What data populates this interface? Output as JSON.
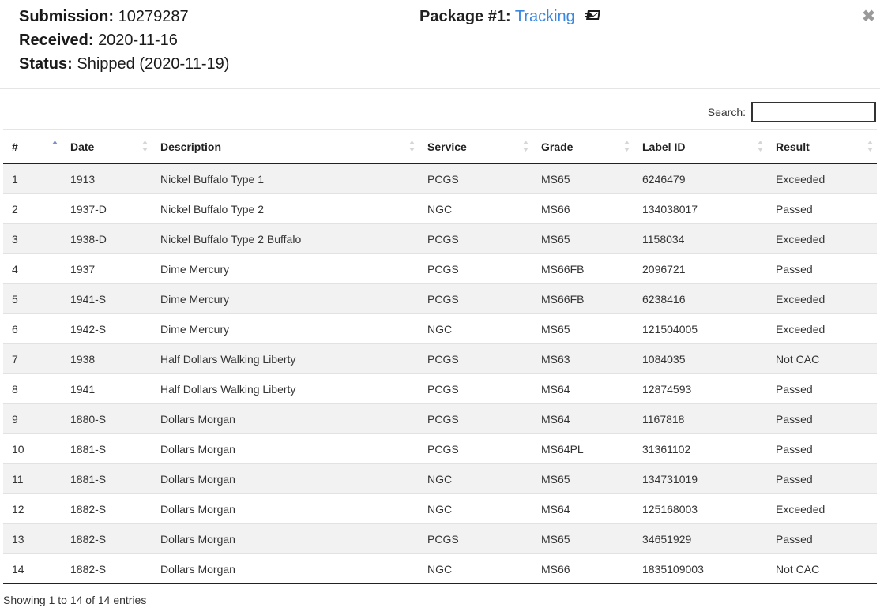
{
  "header": {
    "submission_label": "Submission:",
    "submission_value": "10279287",
    "received_label": "Received:",
    "received_value": "2020-11-16",
    "status_label": "Status:",
    "status_value": "Shipped (2020-11-19)",
    "package_label": "Package #1:",
    "tracking_link": "Tracking",
    "mail_icon": "usps-mail-icon",
    "close_glyph": "✖"
  },
  "search": {
    "label": "Search:",
    "value": ""
  },
  "table": {
    "columns": [
      "#",
      "Date",
      "Description",
      "Service",
      "Grade",
      "Label ID",
      "Result"
    ],
    "sorted_column": "#",
    "sort_direction": "ascending",
    "rows": [
      [
        "1",
        "1913",
        "Nickel Buffalo Type 1",
        "PCGS",
        "MS65",
        "6246479",
        "Exceeded"
      ],
      [
        "2",
        "1937-D",
        "Nickel Buffalo Type 2",
        "NGC",
        "MS66",
        "134038017",
        "Passed"
      ],
      [
        "3",
        "1938-D",
        "Nickel Buffalo Type 2 Buffalo",
        "PCGS",
        "MS65",
        "1158034",
        "Exceeded"
      ],
      [
        "4",
        "1937",
        "Dime Mercury",
        "PCGS",
        "MS66FB",
        "2096721",
        "Passed"
      ],
      [
        "5",
        "1941-S",
        "Dime Mercury",
        "PCGS",
        "MS66FB",
        "6238416",
        "Exceeded"
      ],
      [
        "6",
        "1942-S",
        "Dime Mercury",
        "NGC",
        "MS65",
        "121504005",
        "Exceeded"
      ],
      [
        "7",
        "1938",
        "Half Dollars Walking Liberty",
        "PCGS",
        "MS63",
        "1084035",
        "Not CAC"
      ],
      [
        "8",
        "1941",
        "Half Dollars Walking Liberty",
        "PCGS",
        "MS64",
        "12874593",
        "Passed"
      ],
      [
        "9",
        "1880-S",
        "Dollars Morgan",
        "PCGS",
        "MS64",
        "1167818",
        "Passed"
      ],
      [
        "10",
        "1881-S",
        "Dollars Morgan",
        "PCGS",
        "MS64PL",
        "31361102",
        "Passed"
      ],
      [
        "11",
        "1881-S",
        "Dollars Morgan",
        "NGC",
        "MS65",
        "134731019",
        "Passed"
      ],
      [
        "12",
        "1882-S",
        "Dollars Morgan",
        "NGC",
        "MS64",
        "125168003",
        "Exceeded"
      ],
      [
        "13",
        "1882-S",
        "Dollars Morgan",
        "PCGS",
        "MS65",
        "34651929",
        "Passed"
      ],
      [
        "14",
        "1882-S",
        "Dollars Morgan",
        "NGC",
        "MS66",
        "1835109003",
        "Not CAC"
      ]
    ]
  },
  "footer": {
    "info": "Showing 1 to 14 of 14 entries"
  },
  "colors": {
    "link": "#3a87e0",
    "stripe": "#f2f2f2",
    "sort_active": "#7b8ec9",
    "sort_inactive": "#d6d6d6"
  }
}
